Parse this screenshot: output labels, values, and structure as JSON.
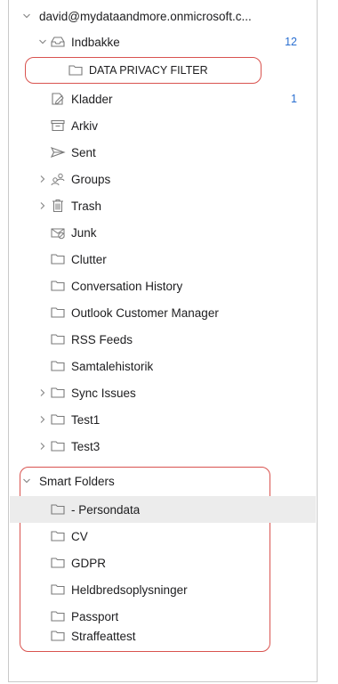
{
  "account": {
    "name": "david@mydataandmore.onmicrosoft.c..."
  },
  "inbox": {
    "label": "Indbakke",
    "count": "12"
  },
  "subfolder": {
    "label": "DATA PRIVACY FILTER"
  },
  "folders": [
    {
      "label": "Kladder",
      "count": "1",
      "icon": "drafts-icon"
    },
    {
      "label": "Arkiv",
      "icon": "archive-icon"
    },
    {
      "label": "Sent",
      "icon": "sent-icon"
    },
    {
      "label": "Groups",
      "icon": "groups-icon"
    },
    {
      "label": "Trash",
      "icon": "trash-icon"
    },
    {
      "label": "Junk",
      "icon": "junk-icon"
    },
    {
      "label": "Clutter",
      "icon": "folder-icon"
    },
    {
      "label": "Conversation History",
      "icon": "folder-icon"
    },
    {
      "label": "Outlook Customer Manager",
      "icon": "folder-icon"
    },
    {
      "label": "RSS Feeds",
      "icon": "folder-icon"
    },
    {
      "label": "Samtalehistorik",
      "icon": "folder-icon"
    },
    {
      "label": "Sync Issues",
      "icon": "folder-icon"
    },
    {
      "label": "Test1",
      "icon": "folder-icon"
    },
    {
      "label": "Test3",
      "icon": "folder-icon"
    }
  ],
  "smart_folders": {
    "label": "Smart Folders",
    "items": [
      {
        "label": "- Persondata"
      },
      {
        "label": "CV"
      },
      {
        "label": "GDPR"
      },
      {
        "label": "Heldbredsoplysninger"
      },
      {
        "label": "Passport"
      },
      {
        "label": "Straffeattest"
      }
    ]
  },
  "colors": {
    "highlight_border": "#d9534f",
    "count_blue": "#2a6fd1",
    "selected_bg": "#ececec"
  }
}
